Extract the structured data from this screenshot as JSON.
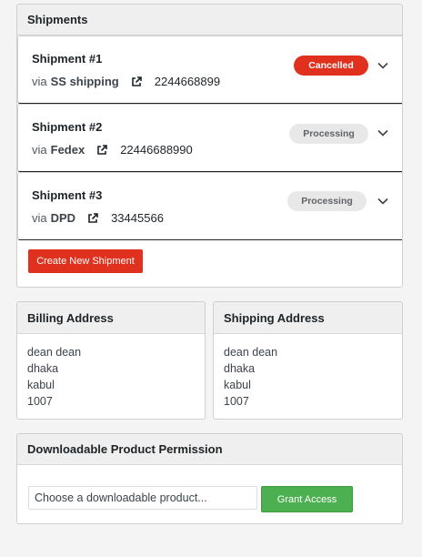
{
  "shipments": {
    "title": "Shipments",
    "items": [
      {
        "title": "Shipment #1",
        "via": "via",
        "carrier": "SS shipping",
        "tracking": "2244668899",
        "status": "Cancelled"
      },
      {
        "title": "Shipment #2",
        "via": "via",
        "carrier": "Fedex",
        "tracking": "22446688990",
        "status": "Processing"
      },
      {
        "title": "Shipment #3",
        "via": "via",
        "carrier": "DPD",
        "tracking": "33445566",
        "status": "Processing"
      }
    ],
    "create_label": "Create New Shipment"
  },
  "billing": {
    "title": "Billing Address",
    "lines": [
      "dean dean",
      "dhaka",
      "kabul",
      "1007"
    ]
  },
  "shipping": {
    "title": "Shipping Address",
    "lines": [
      "dean dean",
      "dhaka",
      "kabul",
      "1007"
    ]
  },
  "downloadable": {
    "title": "Downloadable Product Permission",
    "select_placeholder": "Choose a downloadable product...",
    "grant_label": "Grant Access"
  },
  "colors": {
    "cancelled": "#e0301e",
    "processing": "#e8e8e8",
    "grant": "#4caf50"
  },
  "icons": [
    "external-link-icon",
    "chevron-down-icon"
  ]
}
